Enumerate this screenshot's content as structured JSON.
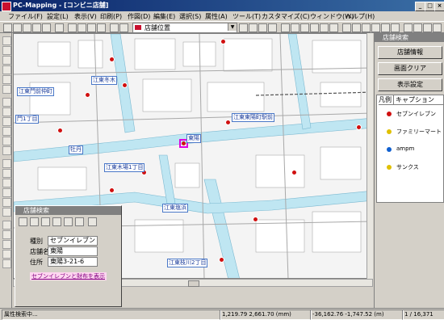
{
  "window": {
    "title": "PC-Mapping - [コンビニ店舗]"
  },
  "menu": [
    "ファイル(F)",
    "設定(L)",
    "表示(V)",
    "印刷(P)",
    "作図(D)",
    "編集(E)",
    "選択(S)",
    "属性(A)",
    "ツール(T)",
    "カスタマイズ(C)",
    "ウィンドウ(W)",
    "ヘルプ(H)"
  ],
  "toolbar": {
    "combo_value": "店舗位置"
  },
  "map": {
    "labels": [
      "江東門前仲町",
      "江東冬木",
      "門1丁目",
      "牡丹",
      "江東木場1丁目",
      "江東東陽町駅前",
      "江東塩浜",
      "江東枝川2丁目",
      "東陽"
    ]
  },
  "right_panel": {
    "title": "店舗検索",
    "buttons": [
      "店舗情報",
      "画面クリア",
      "表示設定"
    ],
    "legend_header": [
      "凡例",
      "キャプション"
    ],
    "legend_items": [
      {
        "label": "セブンイレブン",
        "color": "#d01010"
      },
      {
        "label": "ファミリーマート",
        "color": "#e0c000"
      },
      {
        "label": "ampm",
        "color": "#1060d0"
      },
      {
        "label": "サンクス",
        "color": "#e0c000"
      }
    ]
  },
  "dialog": {
    "title": "店舗検索",
    "fields": [
      {
        "label": "種別",
        "value": "セブンイレブン"
      },
      {
        "label": "店舗名",
        "value": "東陽"
      },
      {
        "label": "住所",
        "value": "東陽3-21-6"
      }
    ],
    "link": "セブンイレブンと財布を表示"
  },
  "status": {
    "message": "属性検索中...",
    "coord1": "1,219.79  2,661.70 (mm)",
    "coord2": "-36,162.76  -1,747.52 (m)",
    "scale": "1 / 16,371"
  }
}
